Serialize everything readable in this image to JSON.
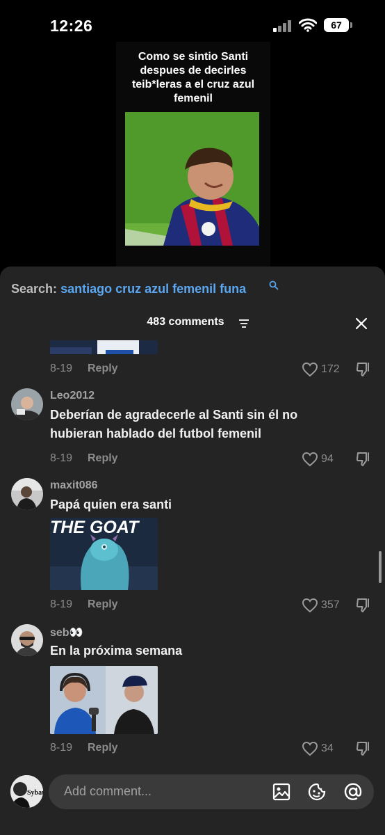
{
  "status_bar": {
    "time": "12:26",
    "battery": "67"
  },
  "video": {
    "caption": "Como se sintio Santi despues de decirles teib*leras a el cruz azul femenil"
  },
  "search": {
    "label": "Search:",
    "query": "santiago cruz azul femenil funa"
  },
  "comments_header": {
    "count_label": "483 comments"
  },
  "comments": [
    {
      "date": "8-19",
      "reply": "Reply",
      "likes": "172"
    },
    {
      "user": "Leo2012",
      "text": "Deberían de agradecerle al Santi sin él no hubieran hablado del futbol femenil",
      "date": "8-19",
      "reply": "Reply",
      "likes": "94"
    },
    {
      "user": "maxit086",
      "text": "Papá quien era santi",
      "image_text": "THE GOAT",
      "date": "8-19",
      "reply": "Reply",
      "likes": "357"
    },
    {
      "user": "seb👀",
      "text": "En la próxima semana",
      "date": "8-19",
      "reply": "Reply",
      "likes": "34"
    }
  ],
  "composer": {
    "placeholder": "Add comment...",
    "avatar_text": "Sybau"
  },
  "icons": [
    "signal-icon",
    "wifi-icon",
    "battery-icon",
    "search-icon",
    "filter-icon",
    "close-icon",
    "heart-icon",
    "dislike-icon",
    "image-icon",
    "emoji-icon",
    "at-icon"
  ],
  "colors": {
    "accent": "#5aa7f2",
    "sheet": "#242424"
  }
}
